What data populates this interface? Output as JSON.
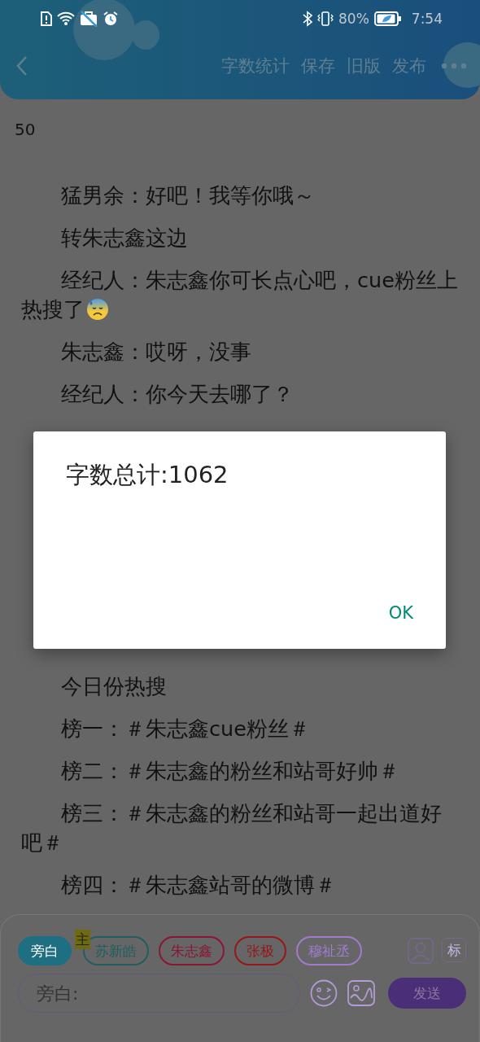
{
  "status_bar": {
    "time": "7:54",
    "battery": "80%"
  },
  "toolbar": {
    "actions": [
      "字数统计",
      "保存",
      "旧版",
      "发布"
    ]
  },
  "page_number": "50",
  "paragraphs_top": [
    {
      "text": "猛男余：好吧！我等你哦～"
    },
    {
      "text": "转朱志鑫这边"
    },
    {
      "text": "经纪人：朱志鑫你可长点心吧，cue粉丝上热搜了",
      "kind": "emoji_end"
    },
    {
      "text": "朱志鑫：哎呀，没事"
    },
    {
      "text": "经纪人：你今天去哪了？"
    }
  ],
  "paragraphs_bottom": [
    {
      "text": "今日份热搜"
    },
    {
      "text": "榜一：＃朱志鑫cue粉丝＃"
    },
    {
      "text": "榜二：＃朱志鑫的粉丝和站哥好帅＃"
    },
    {
      "text": "榜三：＃朱志鑫的粉丝和站哥一起出道好吧＃"
    },
    {
      "text": "榜四：＃朱志鑫站哥的微博＃"
    }
  ],
  "roles": [
    {
      "label": "旁白",
      "color": "#1f6f82",
      "selected": true
    },
    {
      "label": "苏新皓",
      "color": "#1f5f62",
      "selected": false,
      "badge": "主"
    },
    {
      "label": "朱志鑫",
      "color": "#8a1535",
      "selected": false
    },
    {
      "label": "张极",
      "color": "#961818",
      "selected": false
    },
    {
      "label": "穆祉丞",
      "color": "#a07ccc",
      "selected": false
    }
  ],
  "tag_button": "标",
  "input": {
    "placeholder": "旁白:"
  },
  "send_button": "发送",
  "dialog": {
    "title": "字数总计:1062",
    "button": "OK"
  }
}
